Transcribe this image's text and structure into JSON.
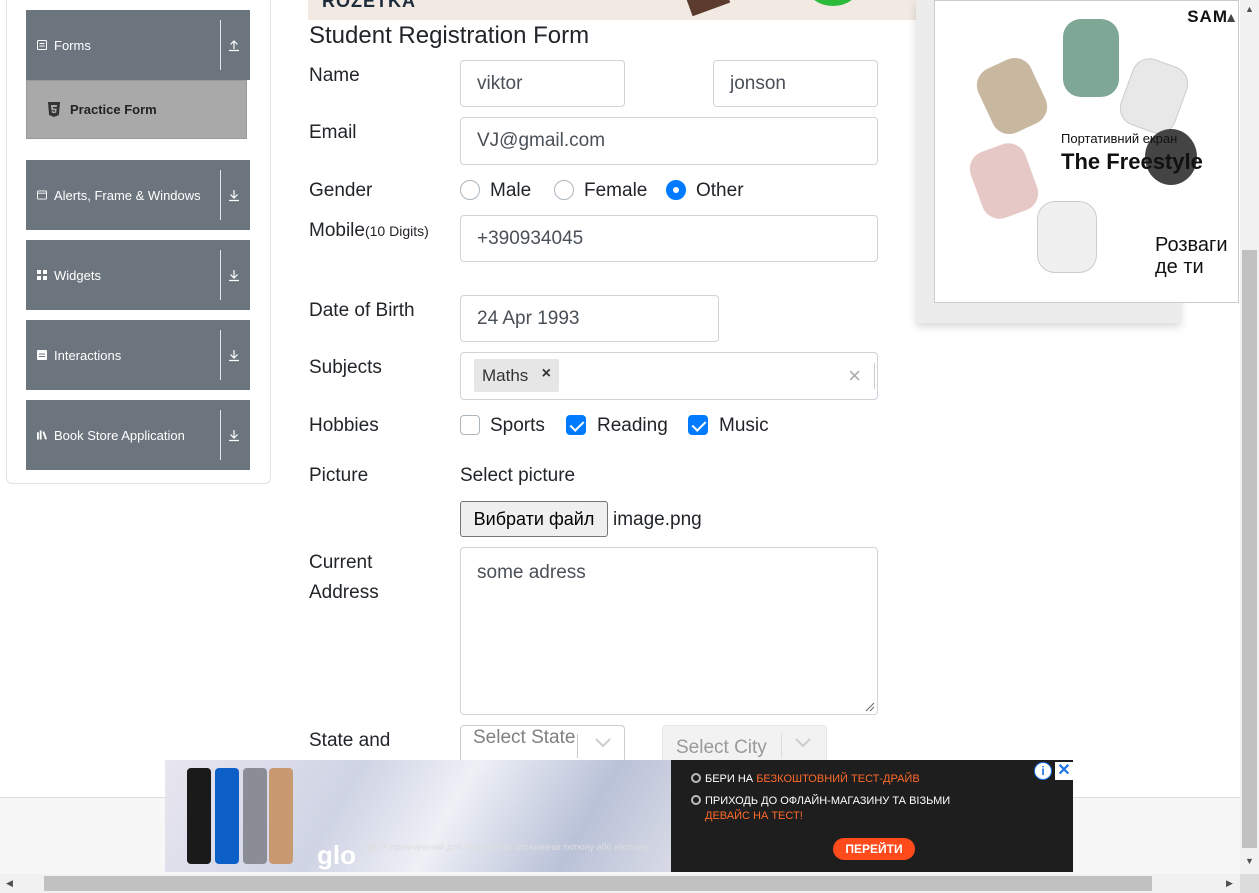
{
  "sidebar": {
    "groups": [
      {
        "label": "Forms",
        "icon": "form-icon",
        "expanded": true
      },
      {
        "label": "Alerts, Frame & Windows",
        "icon": "window-icon",
        "expanded": false
      },
      {
        "label": "Widgets",
        "icon": "widgets-icon",
        "expanded": false
      },
      {
        "label": "Interactions",
        "icon": "interactions-icon",
        "expanded": false
      },
      {
        "label": "Book Store Application",
        "icon": "book-icon",
        "expanded": false
      }
    ],
    "active_item": {
      "label": "Practice Form",
      "icon": "html5-icon"
    }
  },
  "top_banner": {
    "text": "ROZETKA"
  },
  "form": {
    "title": "Student Registration Form",
    "name_label": "Name",
    "first_name": "viktor",
    "last_name": "jonson",
    "email_label": "Email",
    "email": "VJ@gmail.com",
    "gender_label": "Gender",
    "genders": [
      {
        "label": "Male",
        "checked": false
      },
      {
        "label": "Female",
        "checked": false
      },
      {
        "label": "Other",
        "checked": true
      }
    ],
    "mobile_label": "Mobile",
    "mobile_hint": "(10 Digits)",
    "mobile": "+390934045",
    "dob_label": "Date of Birth",
    "dob": "24 Apr 1993",
    "subjects_label": "Subjects",
    "subjects": [
      "Maths"
    ],
    "hobbies_label": "Hobbies",
    "hobbies": [
      {
        "label": "Sports",
        "checked": false
      },
      {
        "label": "Reading",
        "checked": true
      },
      {
        "label": "Music",
        "checked": true
      }
    ],
    "picture_label": "Picture",
    "picture_prompt": "Select picture",
    "file_button": "Вибрати файл",
    "file_name": "image.png",
    "address_label_1": "Current",
    "address_label_2": "Address",
    "address": "some adress",
    "state_city_label": "State and",
    "state_placeholder": "Select State",
    "city_placeholder": "Select City"
  },
  "ad_right": {
    "brand": "SAM",
    "subtitle": "Портативний екран",
    "title": "The Freestyle",
    "cta_line1": "Розваги",
    "cta_line2": "де ти"
  },
  "ad_bottom": {
    "line1_a": "БЕРИ НА ",
    "line1_b": "БЕЗКОШТОВНИЙ ТЕСТ-ДРАЙВ",
    "line2": "ПРИХОДЬ ДО ОФЛАЙН-МАГАЗИНУ ТА ВІЗЬМИ",
    "line3": "ДЕВАЙС НА ТЕСТ!",
    "logo": "glo",
    "disclaimer": "glo™ призначений для повнолітніх споживачів тютюну або нікотину.",
    "button": "ПЕРЕЙТИ",
    "info": "i",
    "close": "✕"
  },
  "colors": {
    "sidebar_group": "#6c757d",
    "active_item": "#a9a9a9",
    "primary": "#007bff",
    "go_button": "#ff4a1c"
  }
}
